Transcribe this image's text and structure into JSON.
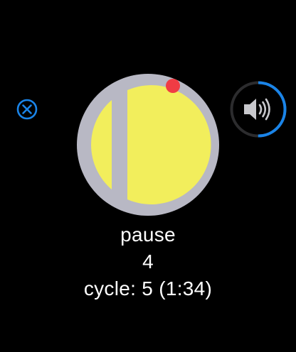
{
  "controls": {
    "close_icon": "close-circle-icon",
    "volume_icon": "speaker-wave-icon",
    "accent_color": "#1a84e8",
    "volume_level": 0.5
  },
  "dial": {
    "ring_color": "#b8b8c4",
    "fill_color": "#f2ee5c",
    "marker_color": "#f03c44",
    "marker_icon": "red-dot-indicator"
  },
  "status": {
    "state": "pause",
    "count": "4",
    "cycle": "cycle: 5 (1:34)"
  }
}
